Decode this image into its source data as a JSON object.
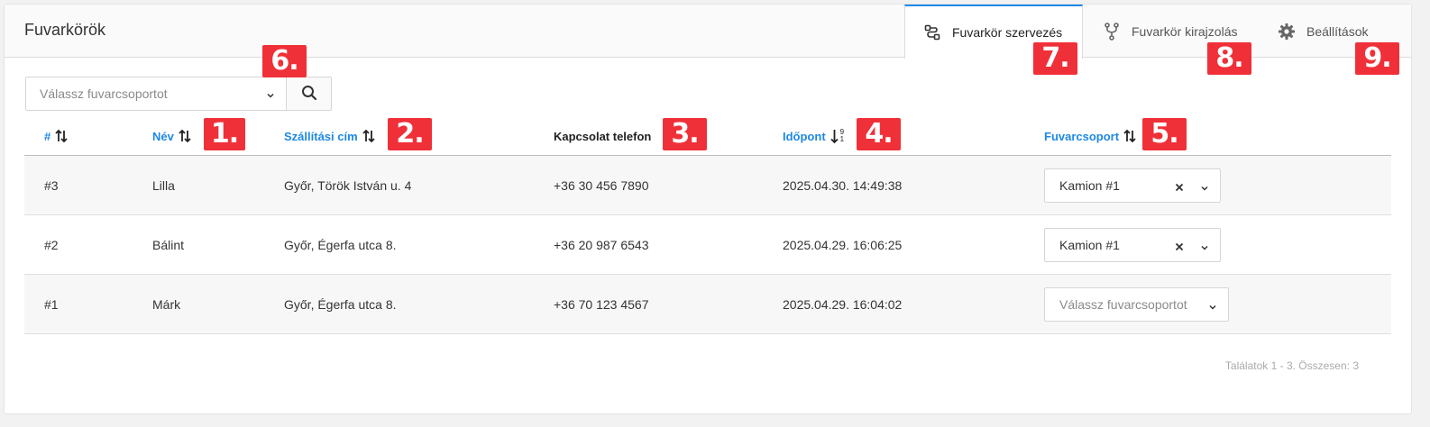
{
  "page": {
    "title": "Fuvarkörök"
  },
  "tabs": [
    {
      "label": "Fuvarkör szervezés",
      "icon": "route-icon",
      "active": true
    },
    {
      "label": "Fuvarkör kirajzolás",
      "icon": "fork-icon",
      "active": false
    },
    {
      "label": "Beállítások",
      "icon": "gear-icon",
      "active": false
    }
  ],
  "filter": {
    "placeholder": "Válassz fuvarcsoportot"
  },
  "columns": [
    {
      "label": "#",
      "sort": "both"
    },
    {
      "label": "Név",
      "sort": "both"
    },
    {
      "label": "Szállítási cím",
      "sort": "both"
    },
    {
      "label": "Kapcsolat telefon",
      "sort": "none"
    },
    {
      "label": "Időpont",
      "sort": "desc-numeric",
      "sort_digit_top": "9",
      "sort_digit_bottom": "1"
    },
    {
      "label": "Fuvarcsoport",
      "sort": "both"
    }
  ],
  "rows": [
    {
      "id": "#3",
      "name": "Lilla",
      "address": "Győr, Török István u. 4",
      "phone": "+36 30 456 7890",
      "time": "2025.04.30. 14:49:38",
      "group": "Kamion #1",
      "group_placeholder": false
    },
    {
      "id": "#2",
      "name": "Bálint",
      "address": "Győr, Égerfa utca 8.",
      "phone": "+36 20 987 6543",
      "time": "2025.04.29. 16:06:25",
      "group": "Kamion #1",
      "group_placeholder": false
    },
    {
      "id": "#1",
      "name": "Márk",
      "address": "Győr, Égerfa utca 8.",
      "phone": "+36 70 123 4567",
      "time": "2025.04.29. 16:04:02",
      "group": "Válassz fuvarcsoportot",
      "group_placeholder": true
    }
  ],
  "pagination": {
    "text": "Találatok 1 - 3. Összesen: 3"
  },
  "annotations": [
    "1.",
    "2.",
    "3.",
    "4.",
    "5.",
    "6.",
    "7.",
    "8.",
    "9."
  ],
  "colors": {
    "accent": "#1e88e5",
    "badge": "#f03038"
  }
}
